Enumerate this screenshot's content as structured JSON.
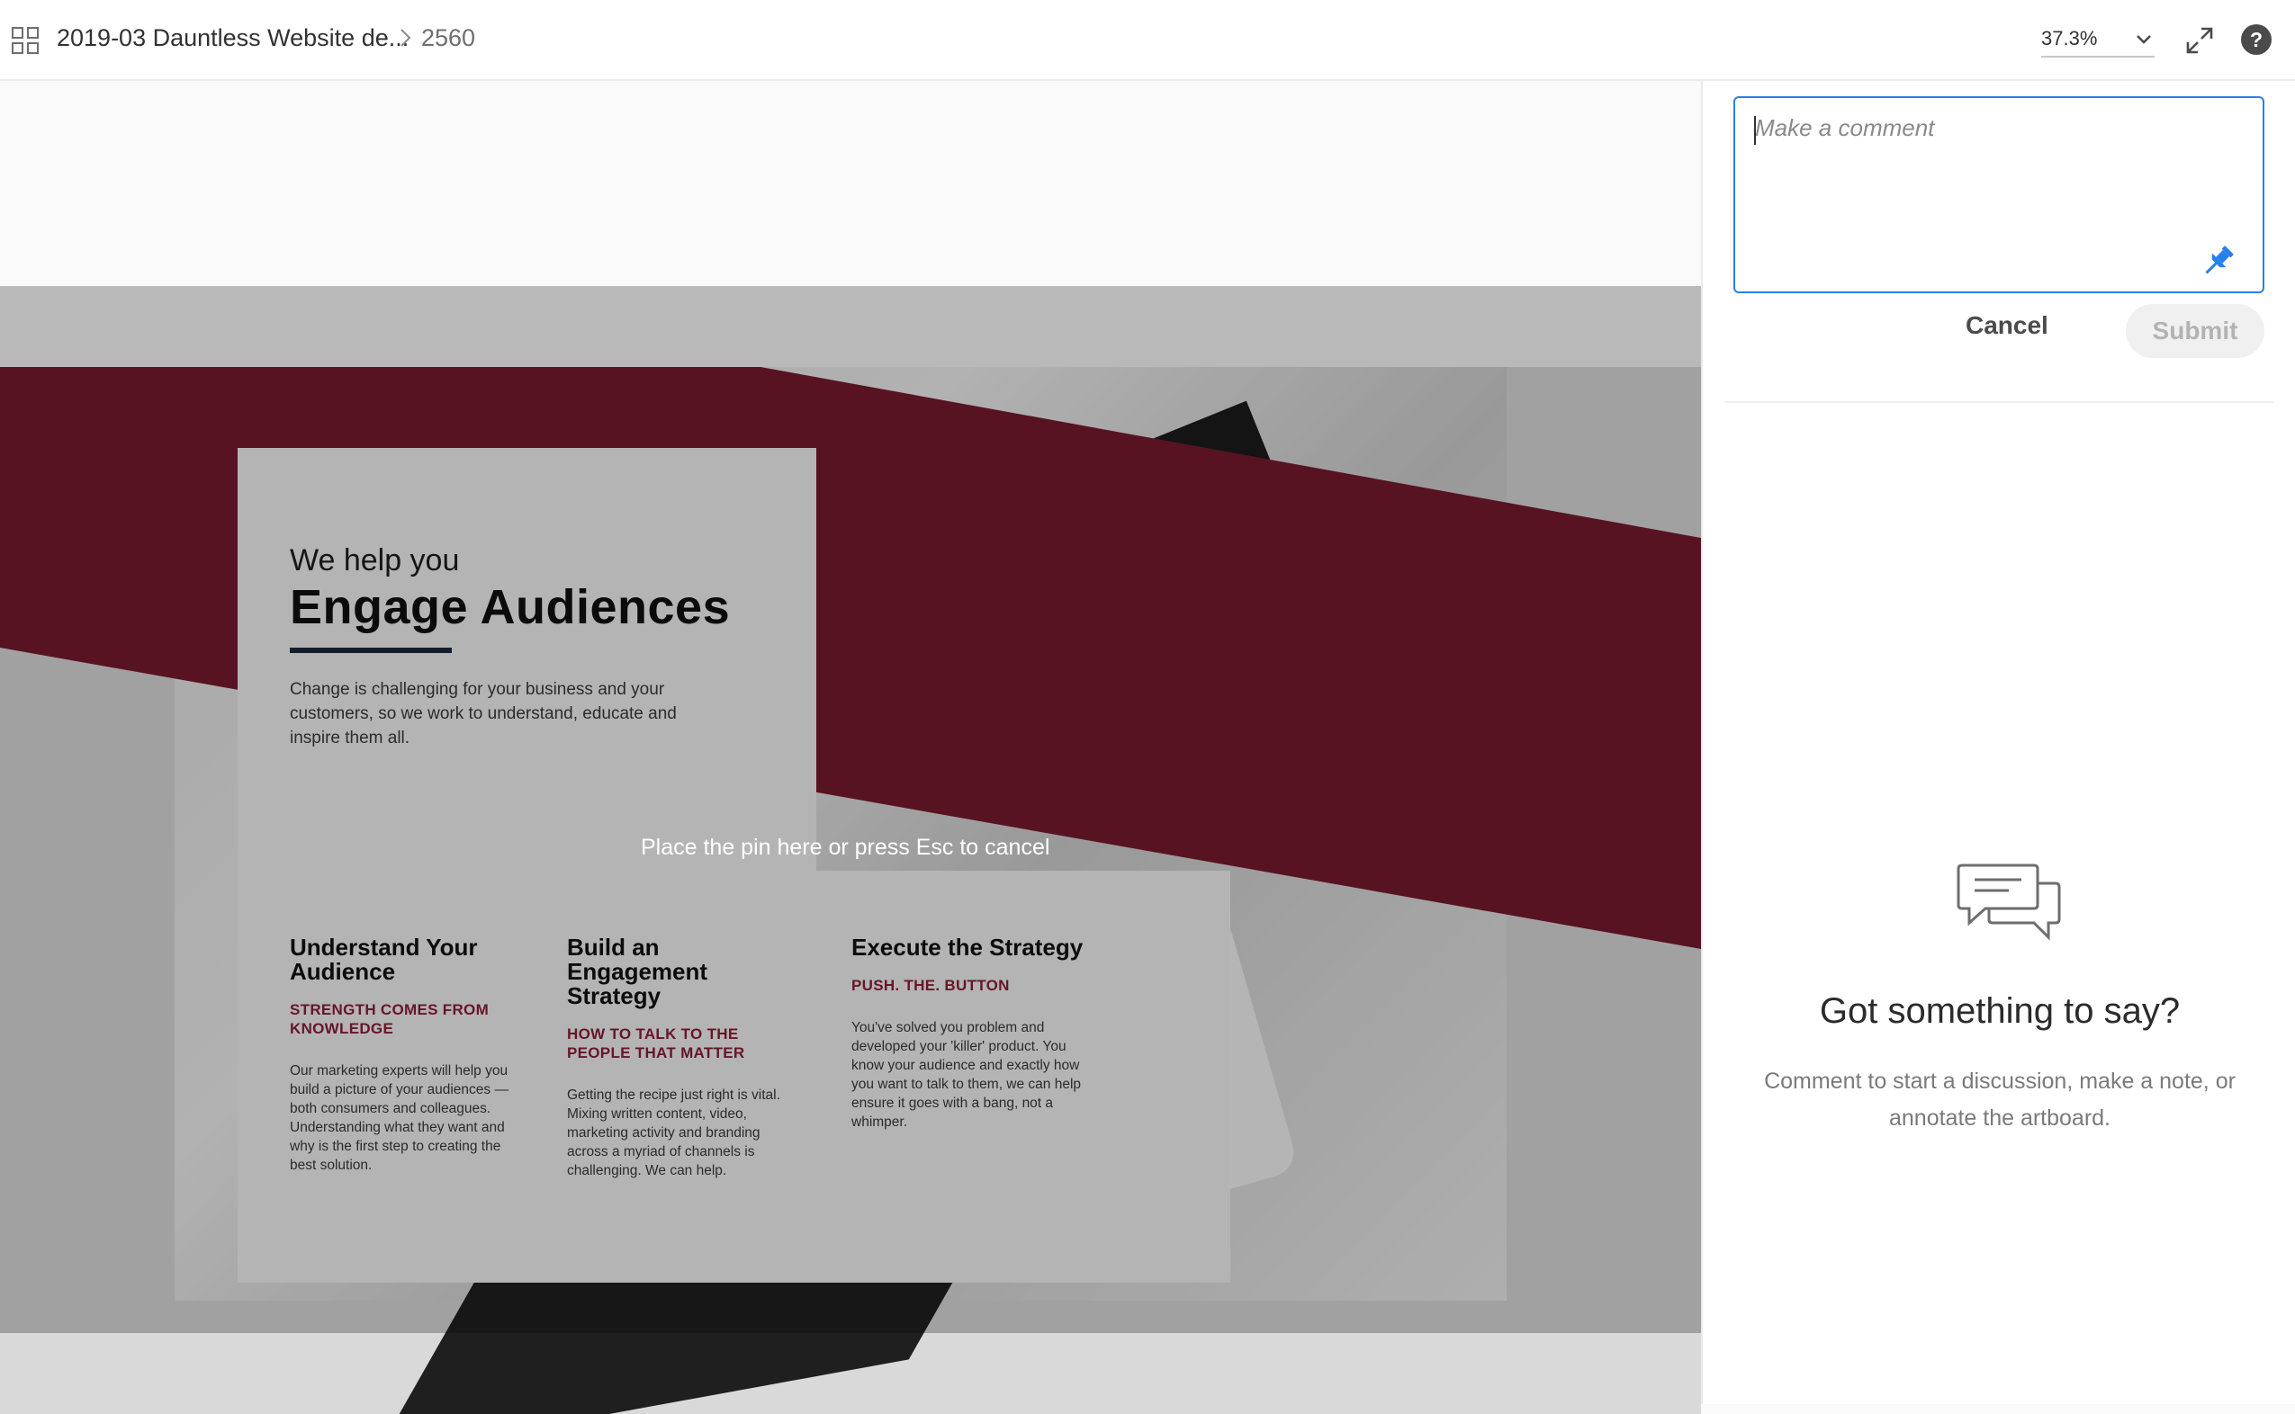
{
  "header": {
    "breadcrumb_title": "2019-03 Dauntless Website de...",
    "breadcrumb_page": "2560",
    "zoom_value": "37.3%"
  },
  "artboard": {
    "kicker": "We help you",
    "headline": "Engage Audiences",
    "intro": "Change is challenging for your business and your customers, so we work to understand, educate and inspire them all.",
    "columns": [
      {
        "heading": "Understand Your Audience",
        "subheading": "STRENGTH COMES FROM KNOWLEDGE",
        "body": "Our marketing experts will help you build a picture of your audiences — both consumers and colleagues. Understanding what they want and why is the first step to creating the best solution."
      },
      {
        "heading": "Build an Engagement Strategy",
        "subheading": "HOW TO TALK TO THE PEOPLE THAT MATTER",
        "body": "Getting the recipe just right is vital. Mixing written content, video, marketing activity and branding across a myriad of channels is challenging. We can help."
      },
      {
        "heading": "Execute the Strategy",
        "subheading": "PUSH. THE. BUTTON",
        "body": "You've solved you problem and developed your 'killer' product. You know your audience and exactly how you want to talk to them, we can help ensure it goes with a bang, not a whimper."
      }
    ],
    "pin_hint": "Place the pin here or press Esc to cancel"
  },
  "comments": {
    "placeholder": "Make a comment",
    "cancel_label": "Cancel",
    "submit_label": "Submit",
    "empty_title": "Got something to say?",
    "empty_description": "Comment to start a discussion, make a note, or annotate the artboard."
  },
  "colors": {
    "brand_band": "#771a2f",
    "accent_blue": "#2680eb",
    "subheading": "#8c1e36"
  }
}
